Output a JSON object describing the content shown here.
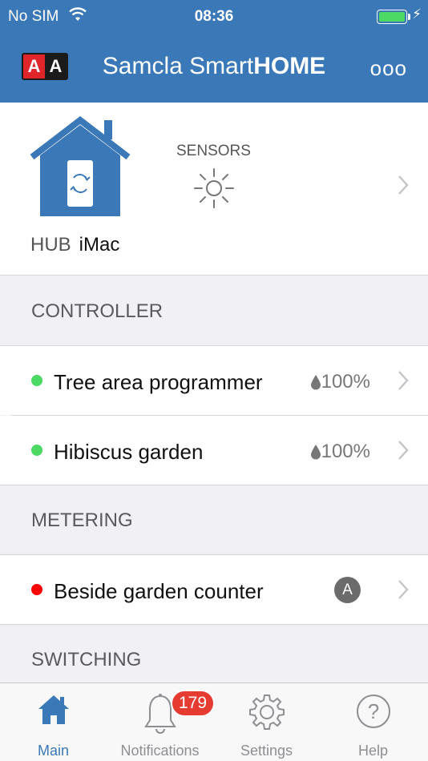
{
  "status_bar": {
    "carrier": "No SIM",
    "time": "08:36"
  },
  "nav": {
    "logo_left": "A",
    "logo_right": "A",
    "title_regular": "Samcla Smart",
    "title_bold": "HOME",
    "more": "ooo"
  },
  "hub": {
    "label": "HUB",
    "name": "iMac",
    "sensors_label": "SENSORS"
  },
  "sections": {
    "controller": "CONTROLLER",
    "metering": "METERING",
    "switching": "SWITCHING"
  },
  "controller_items": [
    {
      "label": "Tree area programmer",
      "level": "100%",
      "status_color": "#4cd964"
    },
    {
      "label": "Hibiscus garden",
      "level": "100%",
      "status_color": "#4cd964"
    }
  ],
  "metering_items": [
    {
      "label": "Beside garden counter",
      "badge": "A",
      "status_color": "#ff0000"
    }
  ],
  "tabs": [
    {
      "label": "Main",
      "icon": "home-icon",
      "active": true
    },
    {
      "label": "Notifications",
      "icon": "bell-icon",
      "badge": "179"
    },
    {
      "label": "Settings",
      "icon": "gear-icon"
    },
    {
      "label": "Help",
      "icon": "help-icon"
    }
  ],
  "colors": {
    "brand": "#3a78b8",
    "badge": "#e63b30"
  }
}
